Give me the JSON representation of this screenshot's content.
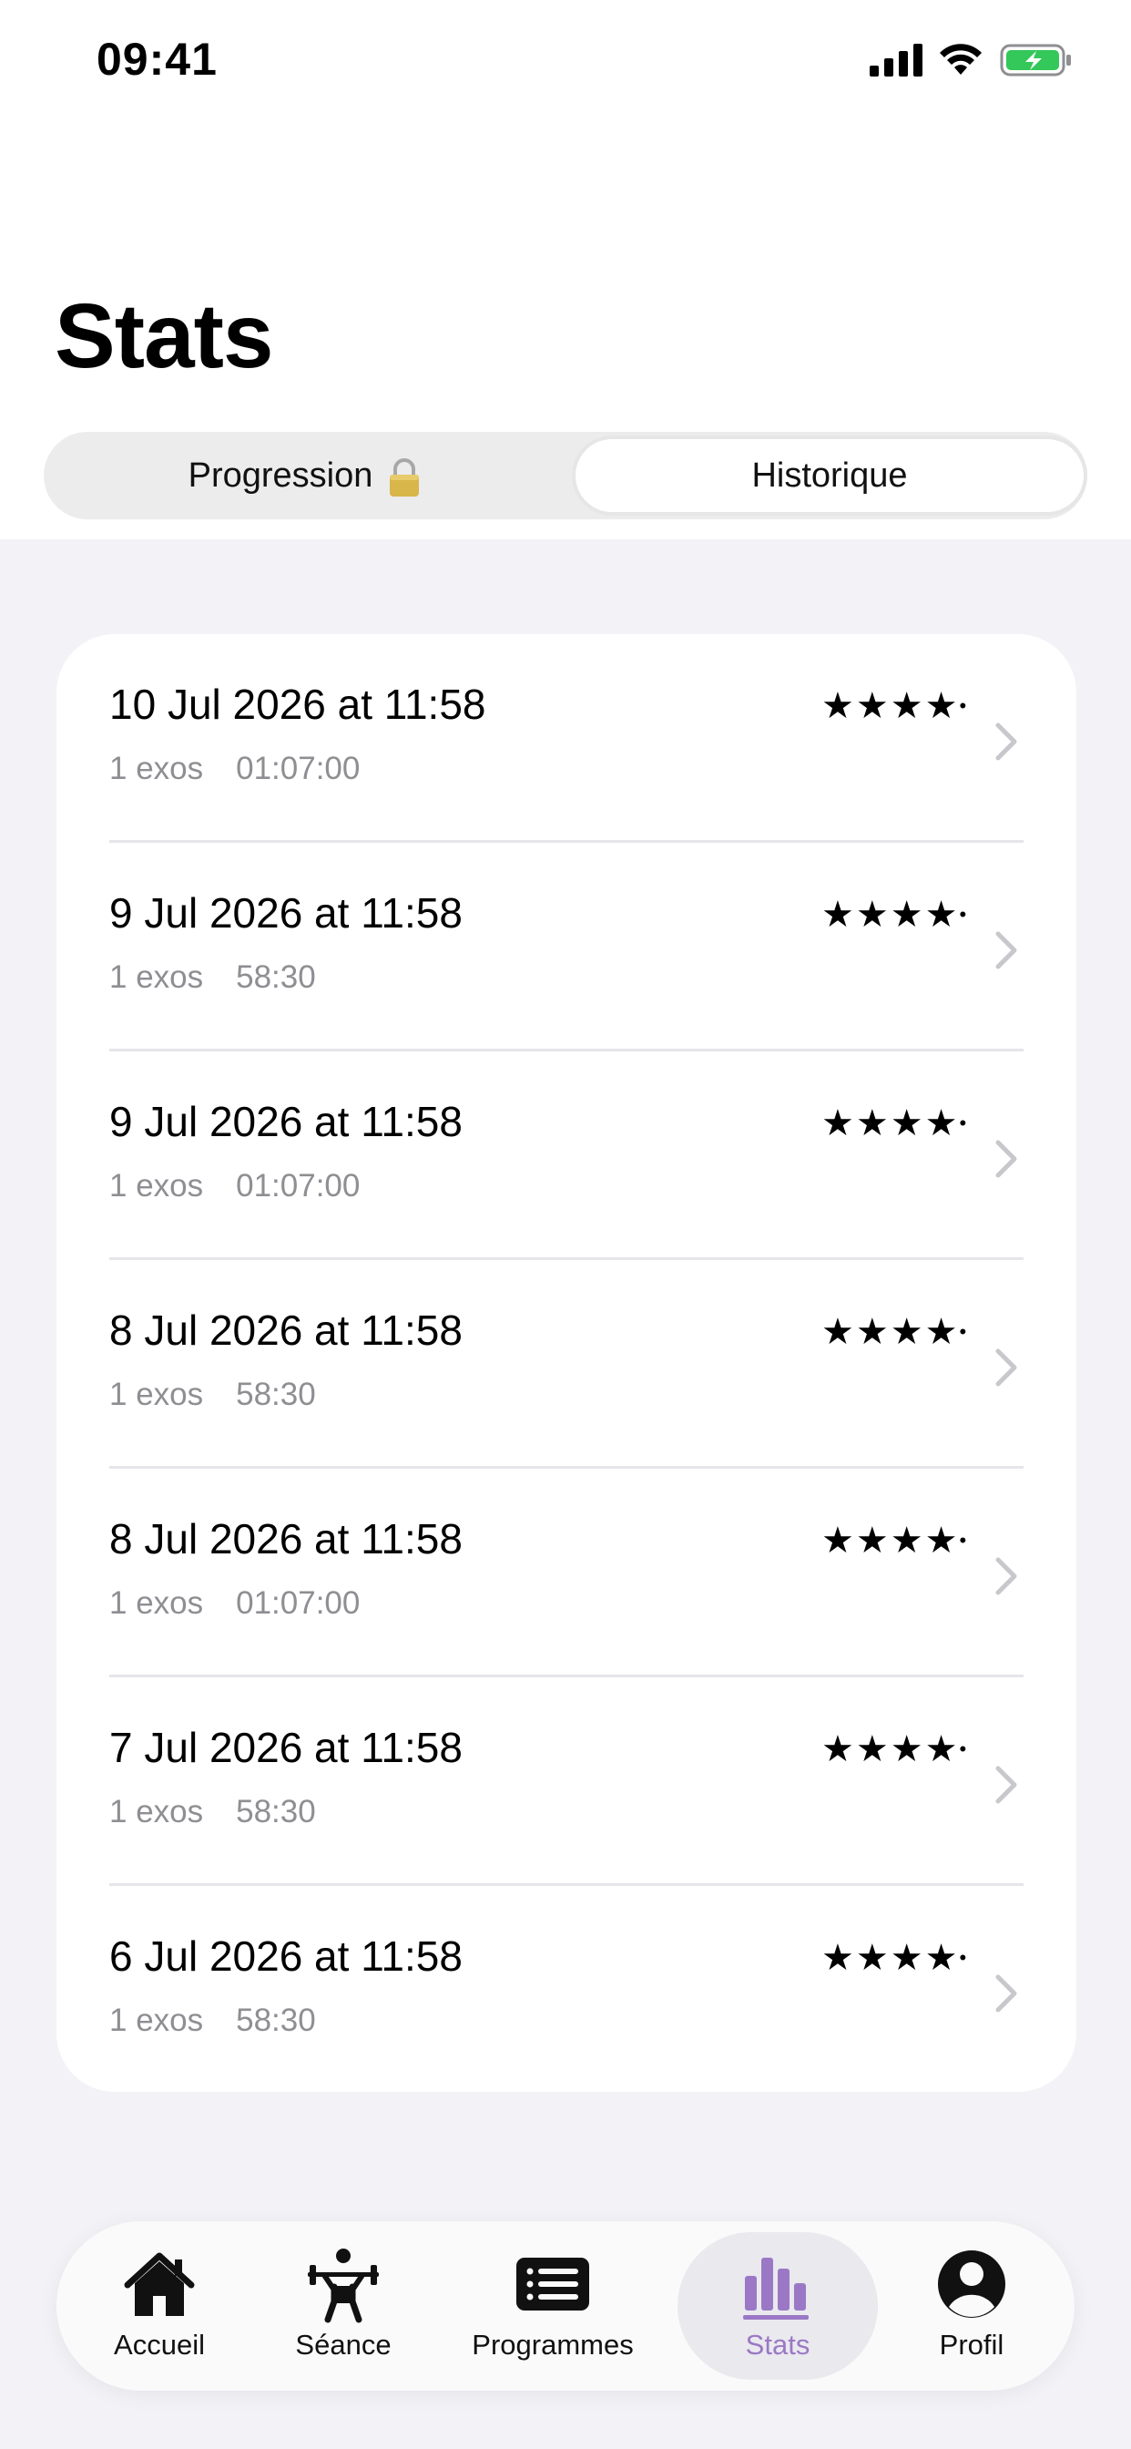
{
  "status_bar": {
    "time": "09:41"
  },
  "header": {
    "title": "Stats"
  },
  "segmented": {
    "tabs": [
      {
        "label": "Progression",
        "locked": true,
        "selected": false
      },
      {
        "label": "Historique",
        "selected": true
      }
    ]
  },
  "sessions": [
    {
      "date": "10 Jul 2026 at 11:58",
      "exercises": "1 exos",
      "duration": "01:07:00",
      "stars": "★★★★"
    },
    {
      "date": "9 Jul 2026 at 11:58",
      "exercises": "1 exos",
      "duration": "58:30",
      "stars": "★★★★"
    },
    {
      "date": "9 Jul 2026 at 11:58",
      "exercises": "1 exos",
      "duration": "01:07:00",
      "stars": "★★★★"
    },
    {
      "date": "8 Jul 2026 at 11:58",
      "exercises": "1 exos",
      "duration": "58:30",
      "stars": "★★★★"
    },
    {
      "date": "8 Jul 2026 at 11:58",
      "exercises": "1 exos",
      "duration": "01:07:00",
      "stars": "★★★★"
    },
    {
      "date": "7 Jul 2026 at 11:58",
      "exercises": "1 exos",
      "duration": "58:30",
      "stars": "★★★★"
    },
    {
      "date": "6 Jul 2026 at 11:58",
      "exercises": "1 exos",
      "duration": "58:30",
      "stars": "★★★★"
    }
  ],
  "tab_bar": {
    "items": [
      {
        "label": "Accueil",
        "icon": "house-icon",
        "active": false
      },
      {
        "label": "Séance",
        "icon": "weightlifter-icon",
        "active": false
      },
      {
        "label": "Programmes",
        "icon": "list-icon",
        "active": false
      },
      {
        "label": "Stats",
        "icon": "chart-bars-icon",
        "active": true
      },
      {
        "label": "Profil",
        "icon": "person-circle-icon",
        "active": false
      }
    ]
  },
  "colors": {
    "accent": "#9b78c5",
    "background": "#f2f2f7",
    "secondary_text": "#8e8e93",
    "battery": "#34c759"
  }
}
